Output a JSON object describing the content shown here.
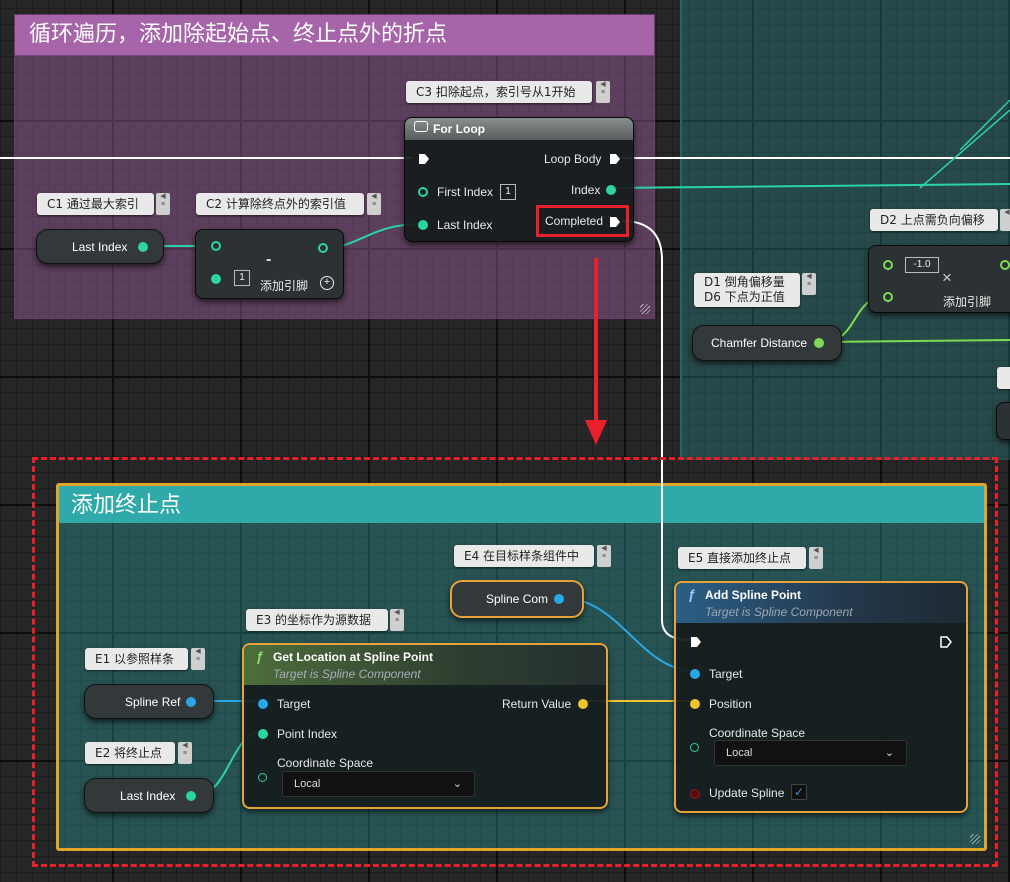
{
  "comments": {
    "loop_title": "循环遍历，添加除起始点、终止点外的折点",
    "end_title": "添加终止点"
  },
  "bubbles": {
    "c1": "C1 通过最大索引",
    "c2": "C2 计算除终点外的索引值",
    "c3": "C3 扣除起点，索引号从1开始",
    "d1_line1": "D1 倒角偏移量",
    "d1_line2": "D6 下点为正值",
    "d2": "D2 上点需负向偏移",
    "e1": "E1 以参照样条",
    "e2": "E2 将终止点",
    "e3": "E3 的坐标作为源数据",
    "e4": "E4 在目标样条组件中",
    "e5": "E5 直接添加终止点"
  },
  "nodes": {
    "last_index_c1": "Last Index",
    "subtract": {
      "op": "-",
      "value": "1",
      "add_pin": "添加引脚"
    },
    "for_loop": {
      "title": "For Loop",
      "first_index_label": "First Index",
      "first_index_value": "1",
      "last_index_label": "Last Index",
      "loop_body_label": "Loop Body",
      "index_label": "Index",
      "completed_label": "Completed"
    },
    "chamfer": "Chamfer Distance",
    "multiply": {
      "value": "-1.0",
      "op": "×",
      "add_pin": "添加引脚"
    },
    "spline_ref": "Spline Ref",
    "last_index_e2": "Last Index",
    "spline_com": "Spline Com",
    "get_location": {
      "title": "Get Location at Spline Point",
      "subtitle": "Target is Spline Component",
      "target": "Target",
      "point_index": "Point Index",
      "coord_space": "Coordinate Space",
      "coord_value": "Local",
      "return_value": "Return Value"
    },
    "add_spline_point": {
      "title": "Add Spline Point",
      "subtitle": "Target is Spline Component",
      "target": "Target",
      "position": "Position",
      "coord_space": "Coordinate Space",
      "coord_value": "Local",
      "update_spline": "Update Spline"
    }
  },
  "colors": {
    "exec_wire": "#ffffff",
    "int_wire": "#2bd3a5",
    "float_wire": "#7ed957",
    "object_wire": "#2aa7e6",
    "vector_wire": "#f2c232",
    "loop_comment": "#9d5fa0",
    "end_comment": "#2fa9a9",
    "highlight": "#e8202a"
  }
}
